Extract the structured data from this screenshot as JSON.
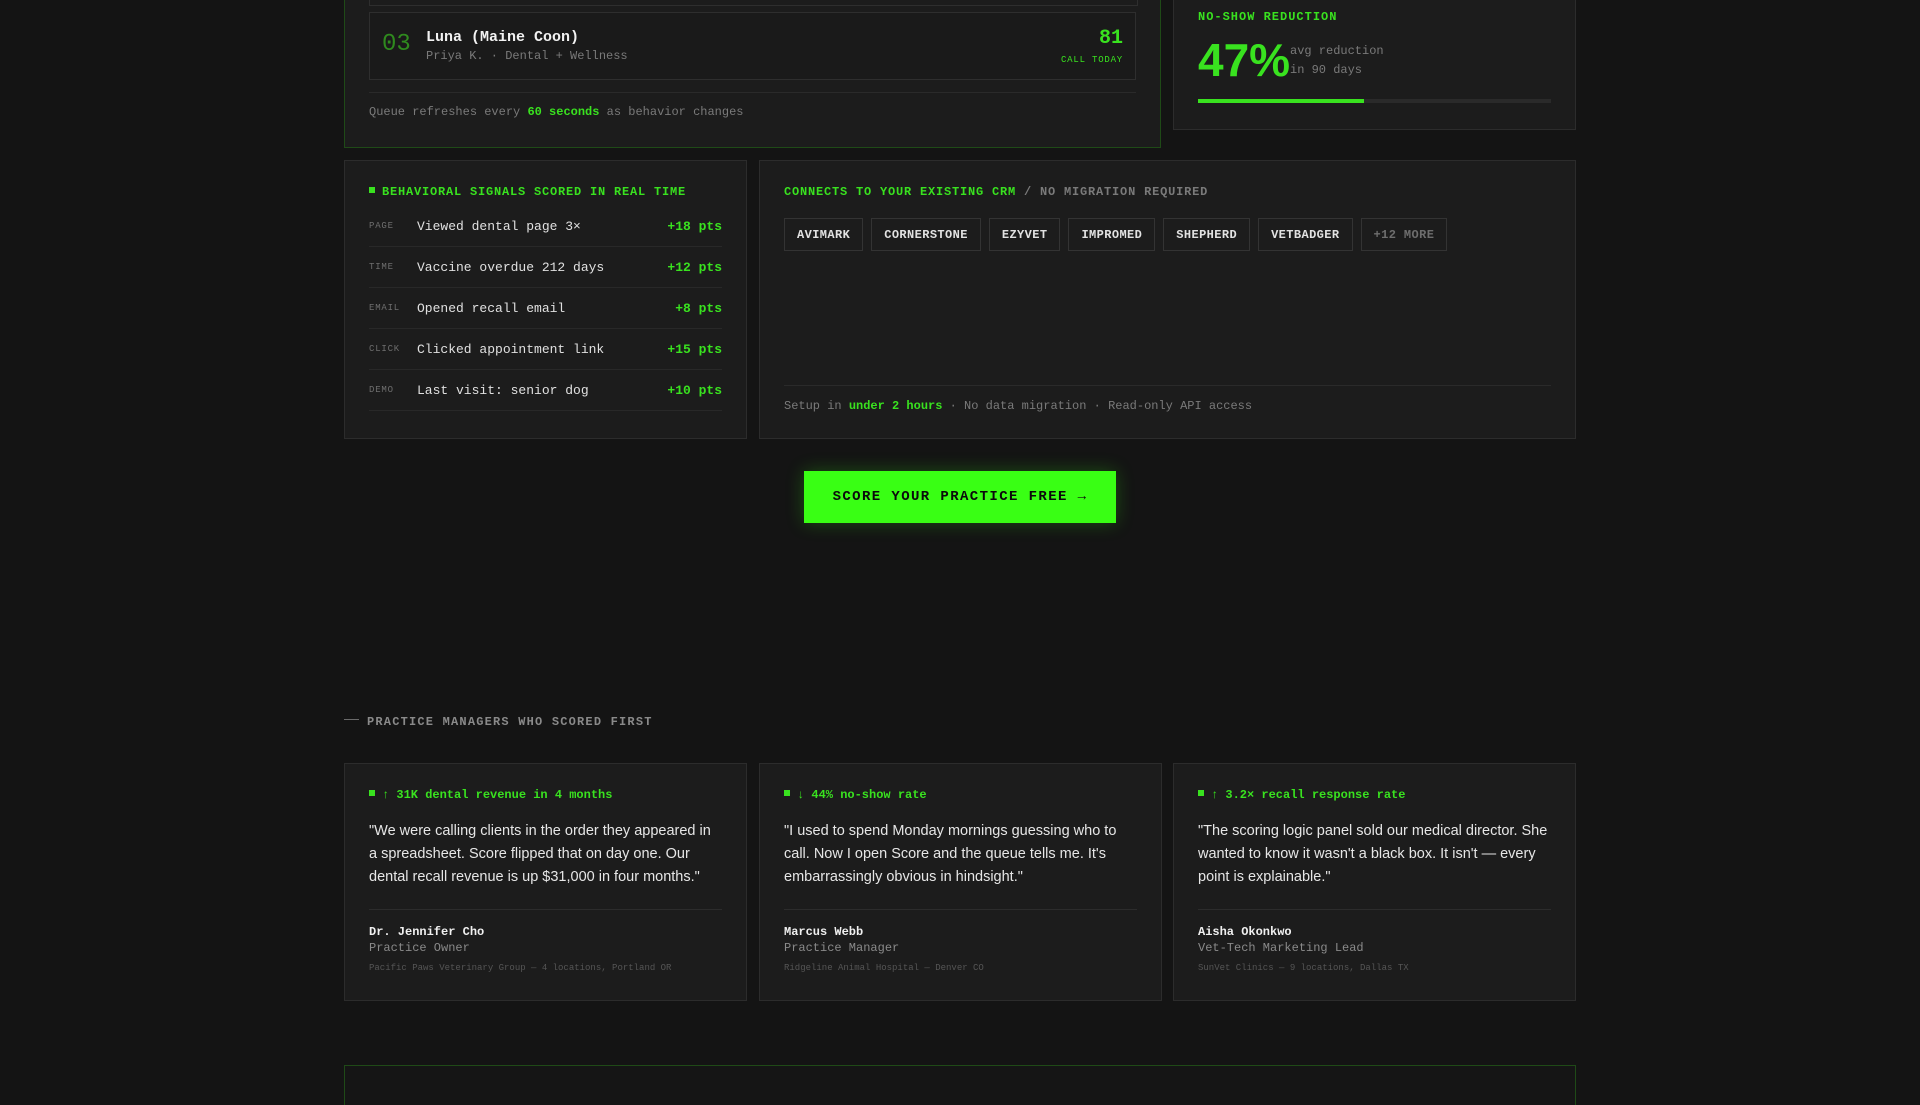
{
  "queue": {
    "item": {
      "rank": "03",
      "name": "Luna (Maine Coon)",
      "owner": "Priya K. · Dental + Wellness",
      "score": "81",
      "action": "CALL TODAY"
    },
    "footer_pre": "Queue refreshes every ",
    "footer_highlight": "60 seconds",
    "footer_post": " as behavior changes"
  },
  "noshow": {
    "title": "NO-SHOW REDUCTION",
    "value": "47%",
    "caption_line1": "avg reduction",
    "caption_line2": "in 90 days",
    "progress_percent": 47
  },
  "signals": {
    "title": "BEHAVIORAL SIGNALS SCORED IN REAL TIME",
    "rows": [
      {
        "key": "PAGE",
        "text": "Viewed dental page 3×",
        "pts": "+18 pts"
      },
      {
        "key": "TIME",
        "text": "Vaccine overdue 212 days",
        "pts": "+12 pts"
      },
      {
        "key": "EMAIL",
        "text": "Opened recall email",
        "pts": "+8 pts"
      },
      {
        "key": "CLICK",
        "text": "Clicked appointment link",
        "pts": "+15 pts"
      },
      {
        "key": "DEMO",
        "text": "Last visit: senior dog",
        "pts": "+10 pts"
      }
    ]
  },
  "crm": {
    "title": "CONNECTS TO YOUR EXISTING CRM",
    "subtitle": " / NO MIGRATION REQUIRED",
    "chips": [
      "AVIMARK",
      "CORNERSTONE",
      "EZYVET",
      "IMPROMED",
      "SHEPHERD",
      "VETBADGER"
    ],
    "more": "+12 MORE",
    "footer_pre": "Setup in ",
    "footer_highlight": "under 2 hours",
    "footer_post": " · No data migration · Read-only API access"
  },
  "cta": {
    "label": "SCORE YOUR PRACTICE FREE →"
  },
  "testimonials": {
    "section_label": "PRACTICE MANAGERS WHO SCORED FIRST",
    "items": [
      {
        "metric": "↑ 31K dental revenue in 4 months",
        "quote": "\"We were calling clients in the order they appeared in a spreadsheet. Score flipped that on day one. Our dental recall revenue is up $31,000 in four months.\"",
        "name": "Dr. Jennifer Cho",
        "role": "Practice Owner",
        "org": "Pacific Paws Veterinary Group — 4 locations, Portland OR"
      },
      {
        "metric": "↓ 44% no-show rate",
        "quote": "\"I used to spend Monday mornings guessing who to call. Now I open Score and the queue tells me. It's embarrassingly obvious in hindsight.\"",
        "name": "Marcus Webb",
        "role": "Practice Manager",
        "org": "Ridgeline Animal Hospital — Denver CO"
      },
      {
        "metric": "↑ 3.2× recall response rate",
        "quote": "\"The scoring logic panel sold our medical director. She wanted to know it wasn't a black box. It isn't — every point is explainable.\"",
        "name": "Aisha Okonkwo",
        "role": "Vet-Tech Marketing Lead",
        "org": "SunVet Clinics — 9 locations, Dallas TX"
      }
    ]
  },
  "colors": {
    "accent": "#39e21f",
    "cta_bg": "#39ff14",
    "background": "#141414",
    "panel": "#1c1c1c"
  }
}
